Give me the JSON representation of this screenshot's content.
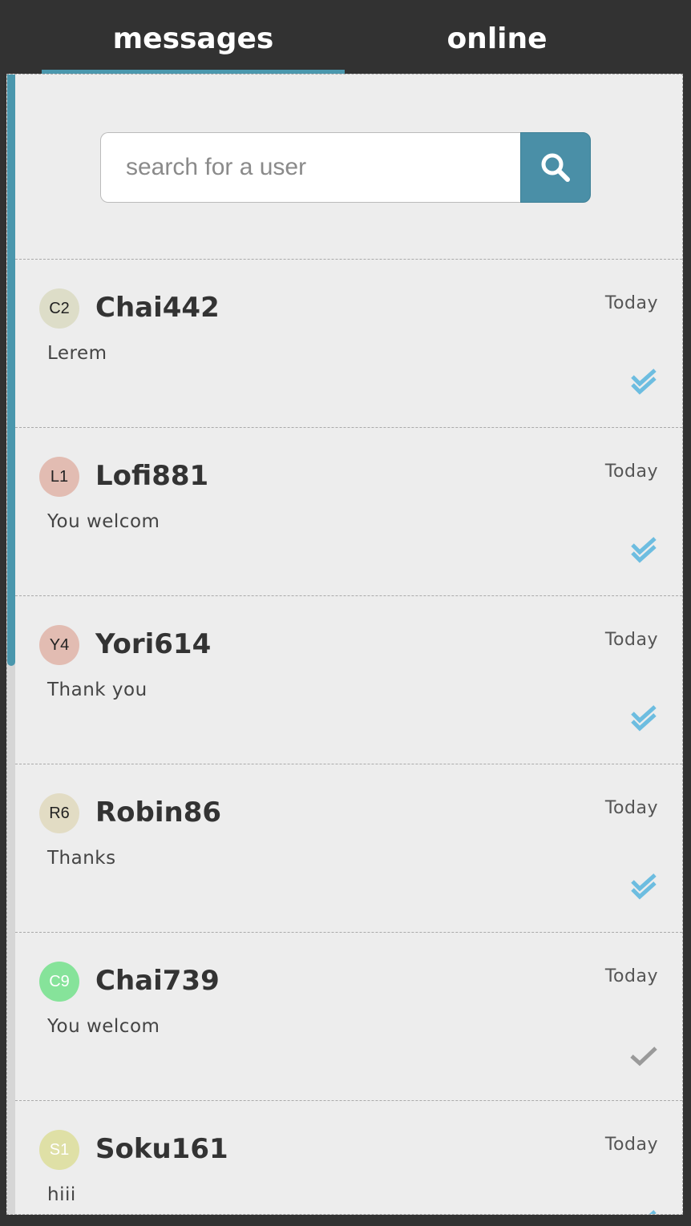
{
  "tabs": [
    {
      "label": "messages",
      "active": true
    },
    {
      "label": "online",
      "active": false
    }
  ],
  "search": {
    "placeholder": "search for a user",
    "value": ""
  },
  "colors": {
    "accent": "#4a97ad",
    "read_check": "#6dbde0",
    "sent_check": "#9a9a9a"
  },
  "conversations": [
    {
      "initials": "C2",
      "avatar_color": "#ddddc8",
      "initials_color": "#222",
      "username": "Chai442",
      "time": "Today",
      "preview": "Lerem",
      "status": "read"
    },
    {
      "initials": "L1",
      "avatar_color": "#e2bcb2",
      "initials_color": "#222",
      "username": "Lofi881",
      "time": "Today",
      "preview": "You welcom",
      "status": "read"
    },
    {
      "initials": "Y4",
      "avatar_color": "#e2bcb2",
      "initials_color": "#222",
      "username": "Yori614",
      "time": "Today",
      "preview": "Thank you",
      "status": "read"
    },
    {
      "initials": "R6",
      "avatar_color": "#e2dcc4",
      "initials_color": "#222",
      "username": "Robin86",
      "time": "Today",
      "preview": "Thanks",
      "status": "read"
    },
    {
      "initials": "C9",
      "avatar_color": "#86e39a",
      "initials_color": "#fff",
      "username": "Chai739",
      "time": "Today",
      "preview": "You welcom",
      "status": "sent"
    },
    {
      "initials": "S1",
      "avatar_color": "#dfe0a6",
      "initials_color": "#fff",
      "username": "Soku161",
      "time": "Today",
      "preview": "hiii",
      "status": "read"
    }
  ]
}
